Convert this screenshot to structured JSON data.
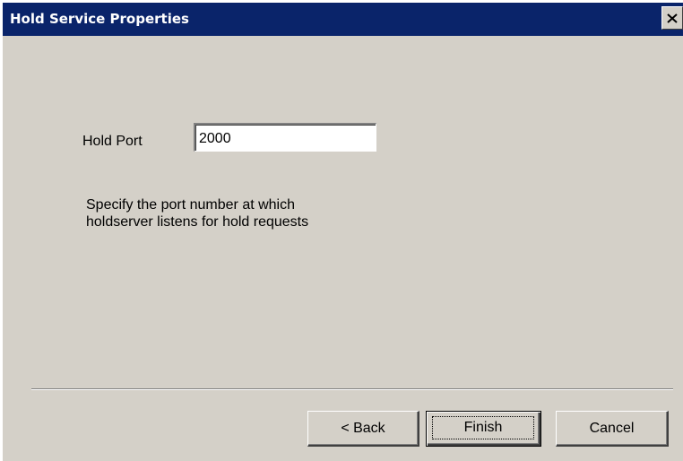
{
  "window": {
    "title": "Hold Service  Properties",
    "close_icon": "close-icon"
  },
  "form": {
    "hold_port_label": "Hold Port",
    "hold_port_value": "2000",
    "help_line_1": "Specify the port number at which",
    "help_line_2": "holdserver listens for hold requests"
  },
  "buttons": {
    "back_label": "< Back",
    "finish_label": "Finish",
    "cancel_label": "Cancel"
  },
  "colors": {
    "titlebar": "#0a246a",
    "dialog_face": "#d4d0c8"
  }
}
